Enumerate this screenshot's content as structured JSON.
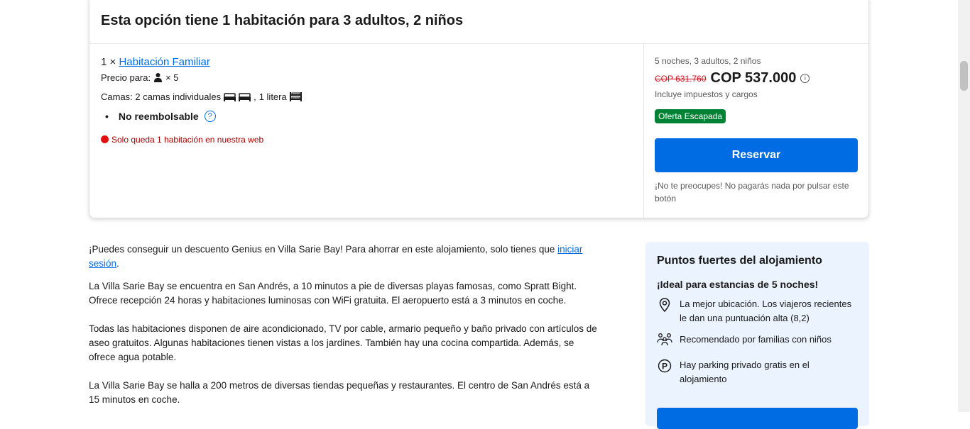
{
  "option": {
    "title": "Esta opción tiene 1 habitación para 3 adultos, 2 niños",
    "room_qty": "1 ×",
    "room_name": "Habitación Familiar",
    "price_for_label": "Precio para:",
    "price_for_count": "× 5",
    "beds_prefix": "Camas: 2 camas individuales",
    "beds_sep": ",",
    "beds_bunk": "1 litera",
    "bullet_text": "No reembolsable",
    "scarcity": "Solo queda 1 habitación en nuestra web"
  },
  "pricing": {
    "summary": "5 noches, 3 adultos, 2 niños",
    "old_price": "COP 631.760",
    "new_price": "COP 537.000",
    "taxes": "Incluye impuestos y cargos",
    "deal_badge": "Oferta Escapada",
    "reserve_label": "Reservar",
    "reassurance": "¡No te preocupes! No pagarás nada por pulsar este botón"
  },
  "description": {
    "genius_text": "¡Puedes conseguir un descuento Genius en Villa Sarie Bay! Para ahorrar en este alojamiento, solo tienes que",
    "genius_link": "iniciar sesión",
    "genius_end": ".",
    "p1": "La Villa Sarie Bay se encuentra en San Andrés, a 10 minutos a pie de diversas playas famosas, como Spratt Bight. Ofrece recepción 24 horas y habitaciones luminosas con WiFi gratuita. El aeropuerto está a 3 minutos en coche.",
    "p2": "Todas las habitaciones disponen de aire acondicionado, TV por cable, armario pequeño y baño privado con artículos de aseo gratuitos. Algunas habitaciones tienen vistas a los jardines. También hay una cocina compartida. Además, se ofrece agua potable.",
    "p3": "La Villa Sarie Bay se halla a 200 metros de diversas tiendas pequeñas y restaurantes. El centro de San Andrés está a 15 minutos en coche."
  },
  "highlights": {
    "title": "Puntos fuertes del alojamiento",
    "subtitle": "¡Ideal para estancias de 5 noches!",
    "items": [
      {
        "icon": "location-pin-icon",
        "text": "La mejor ubicación. Los viajeros recientes le dan una puntuación alta (8,2)"
      },
      {
        "icon": "family-icon",
        "text": "Recomendado por familias con niños"
      },
      {
        "icon": "parking-icon",
        "text": "Hay parking privado gratis en el alojamiento"
      }
    ]
  },
  "colors": {
    "accent": "#006ce4",
    "deal": "#008234",
    "strike": "#d4111e",
    "scarcity": "#a30000"
  }
}
